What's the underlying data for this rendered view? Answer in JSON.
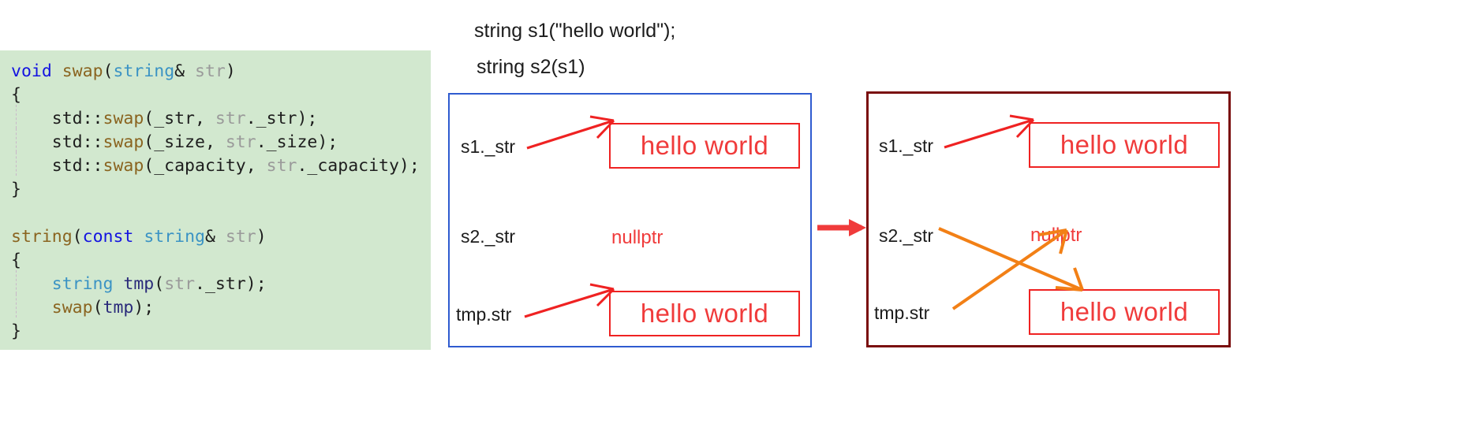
{
  "code_panel": {
    "background_color": "#d2e8cf",
    "lines": [
      [
        {
          "t": "void",
          "c": "kw"
        },
        {
          "t": " ",
          "c": "plain"
        },
        {
          "t": "swap",
          "c": "fn"
        },
        {
          "t": "(",
          "c": "plain"
        },
        {
          "t": "string",
          "c": "type"
        },
        {
          "t": "& ",
          "c": "plain"
        },
        {
          "t": "str",
          "c": "param"
        },
        {
          "t": ")",
          "c": "plain"
        }
      ],
      [
        {
          "t": "{",
          "c": "plain"
        }
      ],
      [
        {
          "t": "    std::",
          "c": "plain"
        },
        {
          "t": "swap",
          "c": "fn"
        },
        {
          "t": "(_str, ",
          "c": "plain"
        },
        {
          "t": "str",
          "c": "param"
        },
        {
          "t": "._str);",
          "c": "plain"
        }
      ],
      [
        {
          "t": "    std::",
          "c": "plain"
        },
        {
          "t": "swap",
          "c": "fn"
        },
        {
          "t": "(_size, ",
          "c": "plain"
        },
        {
          "t": "str",
          "c": "param"
        },
        {
          "t": "._size);",
          "c": "plain"
        }
      ],
      [
        {
          "t": "    std::",
          "c": "plain"
        },
        {
          "t": "swap",
          "c": "fn"
        },
        {
          "t": "(_capacity, ",
          "c": "plain"
        },
        {
          "t": "str",
          "c": "param"
        },
        {
          "t": "._capacity);",
          "c": "plain"
        }
      ],
      [
        {
          "t": "}",
          "c": "plain"
        }
      ],
      [
        {
          "t": "",
          "c": "plain"
        }
      ],
      [
        {
          "t": "string",
          "c": "fn"
        },
        {
          "t": "(",
          "c": "plain"
        },
        {
          "t": "const",
          "c": "kw"
        },
        {
          "t": " ",
          "c": "plain"
        },
        {
          "t": "string",
          "c": "type"
        },
        {
          "t": "& ",
          "c": "plain"
        },
        {
          "t": "str",
          "c": "param"
        },
        {
          "t": ")",
          "c": "plain"
        }
      ],
      [
        {
          "t": "{",
          "c": "plain"
        }
      ],
      [
        {
          "t": "    ",
          "c": "plain"
        },
        {
          "t": "string",
          "c": "type"
        },
        {
          "t": " ",
          "c": "plain"
        },
        {
          "t": "tmp",
          "c": "var"
        },
        {
          "t": "(",
          "c": "plain"
        },
        {
          "t": "str",
          "c": "param"
        },
        {
          "t": "._str);",
          "c": "plain"
        }
      ],
      [
        {
          "t": "    ",
          "c": "plain"
        },
        {
          "t": "swap",
          "c": "fn"
        },
        {
          "t": "(",
          "c": "plain"
        },
        {
          "t": "tmp",
          "c": "var"
        },
        {
          "t": ");",
          "c": "plain"
        }
      ],
      [
        {
          "t": "}",
          "c": "plain"
        }
      ]
    ],
    "indent_guide_lines": [
      2,
      3,
      4,
      9,
      10
    ]
  },
  "header": {
    "line1": "string s1(\"hello world\");",
    "line2": "string s2(s1)"
  },
  "diagram": {
    "before": {
      "border_color": "#2f5bd0",
      "rows": [
        {
          "label": "s1._str",
          "value": "hello world",
          "value_kind": "box"
        },
        {
          "label": "s2._str",
          "value": "nullptr",
          "value_kind": "text"
        },
        {
          "label": "tmp.str",
          "value": "hello world",
          "value_kind": "box"
        }
      ],
      "arrow_color": "#ef2222"
    },
    "after": {
      "border_color": "#7a0d0d",
      "rows": [
        {
          "label": "s1._str",
          "value": "hello world",
          "value_kind": "box"
        },
        {
          "label": "s2._str",
          "value": "nullptr",
          "value_kind": "text"
        },
        {
          "label": "tmp.str",
          "value": "hello world",
          "value_kind": "box"
        }
      ],
      "arrow_color_s1": "#ef2222",
      "arrow_color_swap": "#f28016"
    },
    "transition_arrow_color": "#f03b3b",
    "value_box_border_color": "#ef2222",
    "value_text_color": "#f03b3b"
  }
}
